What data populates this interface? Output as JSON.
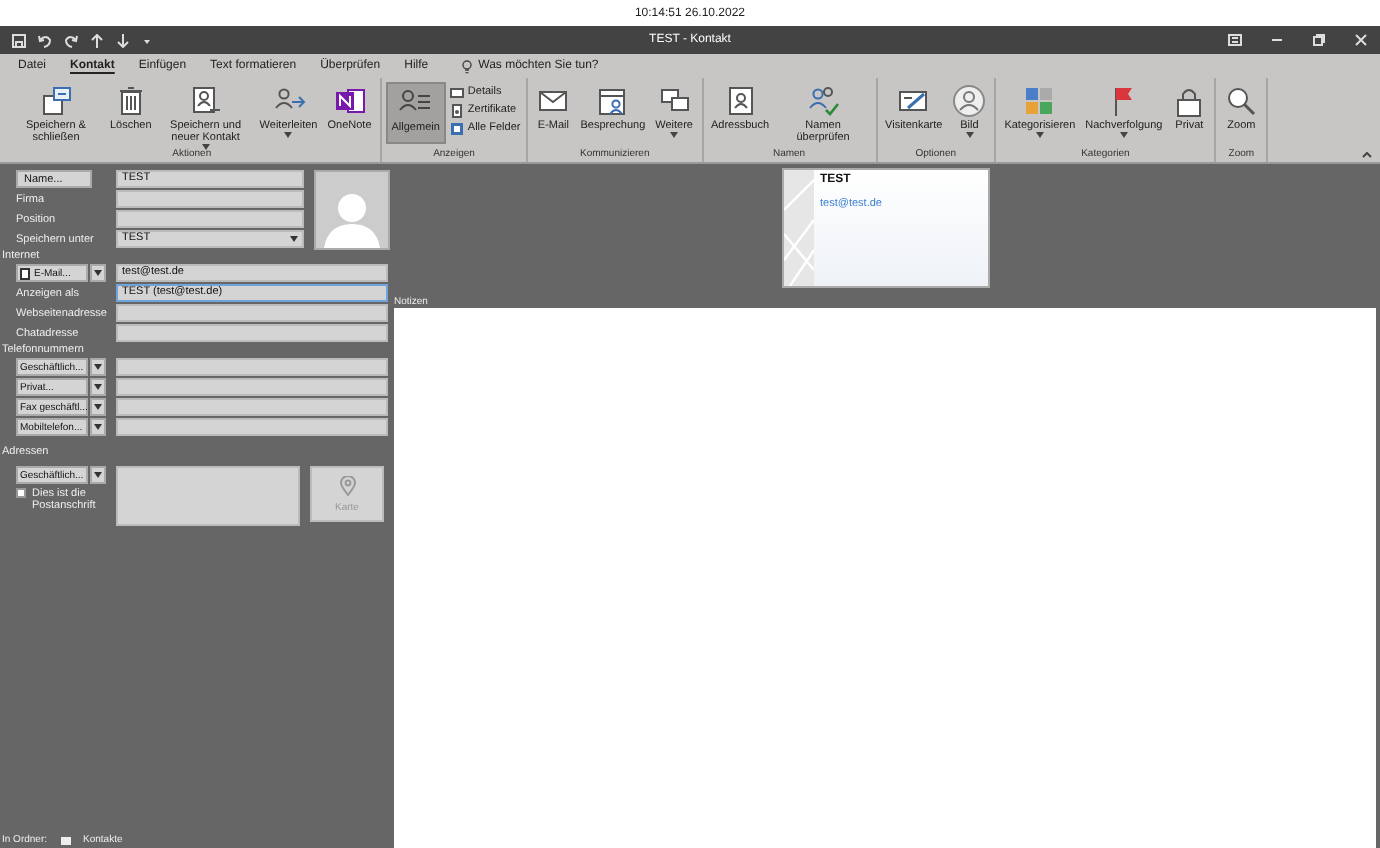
{
  "clock": "10:14:51 26.10.2022",
  "window": {
    "title": "TEST - Kontakt"
  },
  "tabs": [
    {
      "label": "Datei",
      "selected": false
    },
    {
      "label": "Kontakt",
      "selected": true
    },
    {
      "label": "Einfügen",
      "selected": false
    },
    {
      "label": "Text formatieren",
      "selected": false
    },
    {
      "label": "Überprüfen",
      "selected": false
    },
    {
      "label": "Hilfe",
      "selected": false
    }
  ],
  "tell_me": {
    "placeholder": "Was möchten Sie tun?"
  },
  "ribbon_groups": [
    {
      "label": "Aktionen",
      "buttons": [
        {
          "label": "Speichern & schließen",
          "dropdown": false
        },
        {
          "label": "Löschen",
          "dropdown": false
        },
        {
          "label": "Speichern und neuer Kontakt",
          "dropdown": true
        },
        {
          "label": "Weiterleiten",
          "dropdown": true
        },
        {
          "label": "OneNote",
          "dropdown": false
        }
      ]
    },
    {
      "label": "Anzeigen",
      "buttons": [
        {
          "label": "Allgemein",
          "dropdown": false,
          "selected": true
        }
      ],
      "small_buttons": [
        {
          "label": "Details"
        },
        {
          "label": "Zertifikate"
        },
        {
          "label": "Alle Felder"
        }
      ]
    },
    {
      "label": "Kommunizieren",
      "buttons": [
        {
          "label": "E-Mail",
          "dropdown": false
        },
        {
          "label": "Besprechung",
          "dropdown": false
        },
        {
          "label": "Weitere",
          "dropdown": true
        }
      ]
    },
    {
      "label": "Namen",
      "buttons": [
        {
          "label": "Adressbuch",
          "dropdown": false
        },
        {
          "label": "Namen überprüfen",
          "dropdown": false
        }
      ]
    },
    {
      "label": "Optionen",
      "buttons": [
        {
          "label": "Visitenkarte",
          "dropdown": false
        },
        {
          "label": "Bild",
          "dropdown": true
        }
      ]
    },
    {
      "label": "Kategorien",
      "buttons": [
        {
          "label": "Kategorisieren",
          "dropdown": true
        },
        {
          "label": "Nachverfolgung",
          "dropdown": true
        },
        {
          "label": "Privat",
          "dropdown": false
        }
      ]
    },
    {
      "label": "Zoom",
      "buttons": [
        {
          "label": "Zoom",
          "dropdown": false
        }
      ]
    }
  ],
  "form": {
    "name": {
      "button": "Name...",
      "value": "TEST"
    },
    "firma": {
      "label": "Firma"
    },
    "position": {
      "label": "Position"
    },
    "save_as": {
      "label": "Speichern unter",
      "value": "TEST"
    },
    "internet": {
      "label": "Internet",
      "email_button": "E-Mail...",
      "email": "test@test.de",
      "display_as_label": "Anzeigen als",
      "display_as": "TEST (test@test.de)",
      "web_label": "Webseitenadresse",
      "chat_label": "Chatadresse"
    },
    "phones": {
      "label": "Telefonnummern",
      "items": [
        {
          "button": "Geschäftlich..."
        },
        {
          "button": "Privat..."
        },
        {
          "button": "Fax geschäftl..."
        },
        {
          "button": "Mobiltelefon..."
        }
      ]
    },
    "addresses": {
      "label": "Adressen",
      "button": "Geschäftlich...",
      "postal": {
        "label": "Dies ist die Postanschrift",
        "checked": false
      },
      "map_button": {
        "label": "Karte",
        "disabled": true
      }
    }
  },
  "business_card": {
    "name": "TEST",
    "email": "test@test.de"
  },
  "notes": {
    "label": "Notizen"
  },
  "status_bar": {
    "folder_label": "In Ordner:",
    "folder": "Kontakte"
  }
}
